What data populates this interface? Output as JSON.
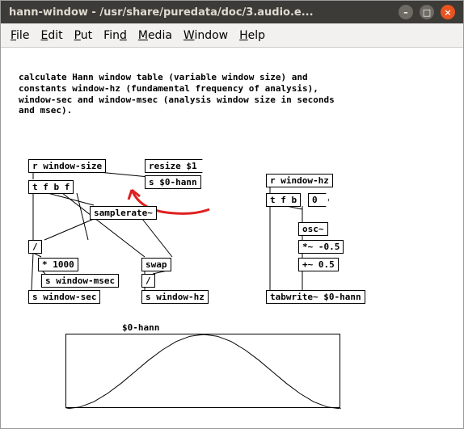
{
  "window": {
    "title": "hann-window - /usr/share/puredata/doc/3.audio.e..."
  },
  "menu": {
    "file": "File",
    "edit": "Edit",
    "put": "Put",
    "find": "Find",
    "media": "Media",
    "window": "Window",
    "help": "Help"
  },
  "comment": "calculate Hann window table (variable window size) and\nconstants window-hz (fundamental frequency of analysis),\nwindow-sec and window-msec (analysis window size in seconds\nand msec).",
  "objects": {
    "r_window_size": "r window-size",
    "resize_msg": "resize $1",
    "s_0_hann_a": "s $0-hann",
    "tfbf": "t f b f",
    "samplerate": "samplerate~",
    "divide1": "/",
    "swap": "swap",
    "times1000": "* 1000",
    "divide2": "/",
    "s_window_msec": "s window-msec",
    "s_window_sec": "s window-sec",
    "s_window_hz": "s window-hz",
    "r_window_hz": "r window-hz",
    "tfb": "t f b",
    "numbox_val": "0",
    "osc": "osc~",
    "times_neg05": "*~ -0.5",
    "plus05": "+~ 0.5",
    "tabwrite": "tabwrite~ $0-hann"
  },
  "graph_label": "$0-hann",
  "chart_data": {
    "type": "line",
    "title": "$0-hann",
    "x": [
      0,
      0.05,
      0.1,
      0.15,
      0.2,
      0.25,
      0.3,
      0.35,
      0.4,
      0.45,
      0.5,
      0.55,
      0.6,
      0.65,
      0.7,
      0.75,
      0.8,
      0.85,
      0.9,
      0.95,
      1.0
    ],
    "values": [
      0.0,
      0.024,
      0.095,
      0.206,
      0.345,
      0.5,
      0.655,
      0.794,
      0.905,
      0.976,
      1.0,
      0.976,
      0.905,
      0.794,
      0.655,
      0.5,
      0.345,
      0.206,
      0.095,
      0.024,
      0.0
    ],
    "ylim": [
      0,
      1
    ],
    "xlabel": "",
    "ylabel": ""
  }
}
